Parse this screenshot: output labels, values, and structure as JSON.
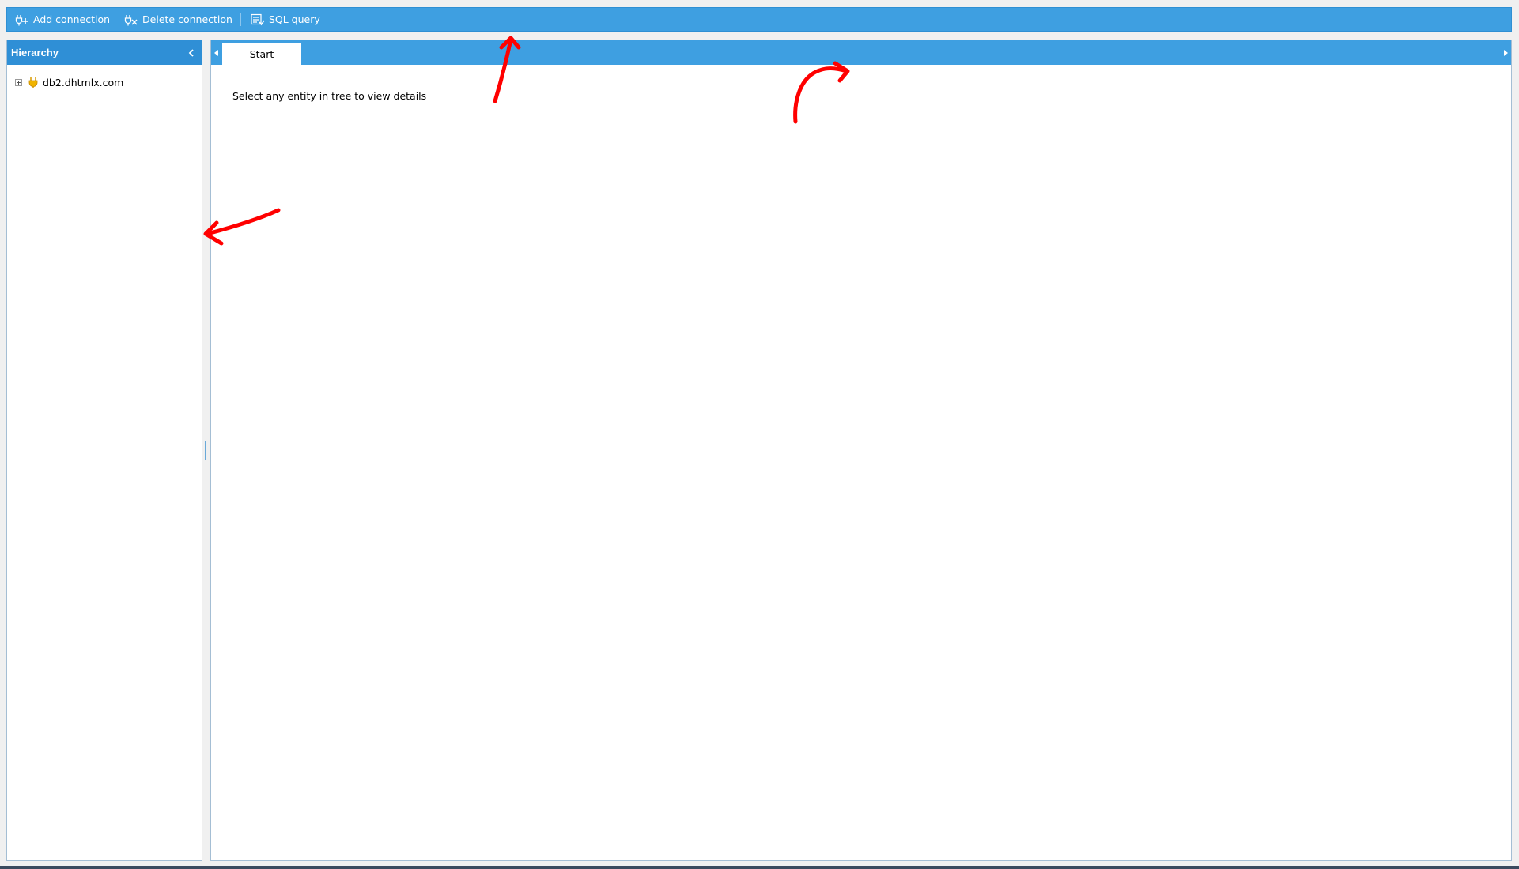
{
  "toolbar": {
    "buttons": [
      {
        "label": "Add connection",
        "icon": "plug-add-icon"
      },
      {
        "label": "Delete connection",
        "icon": "plug-delete-icon"
      },
      {
        "label": "SQL query",
        "icon": "sql-query-icon"
      }
    ]
  },
  "left_panel": {
    "title": "Hierarchy",
    "tree": [
      {
        "label": "db2.dhtmlx.com",
        "icon": "database-plug-icon",
        "expanded": false
      }
    ]
  },
  "right_panel": {
    "tabs": [
      {
        "label": "Start",
        "active": true
      }
    ],
    "content_text": "Select any entity in tree to view details"
  },
  "colors": {
    "toolbar_bg": "#3e9fe1",
    "header_bg": "#2f8fd6",
    "annotation": "#ff0000",
    "db_icon": "#f0b400"
  }
}
